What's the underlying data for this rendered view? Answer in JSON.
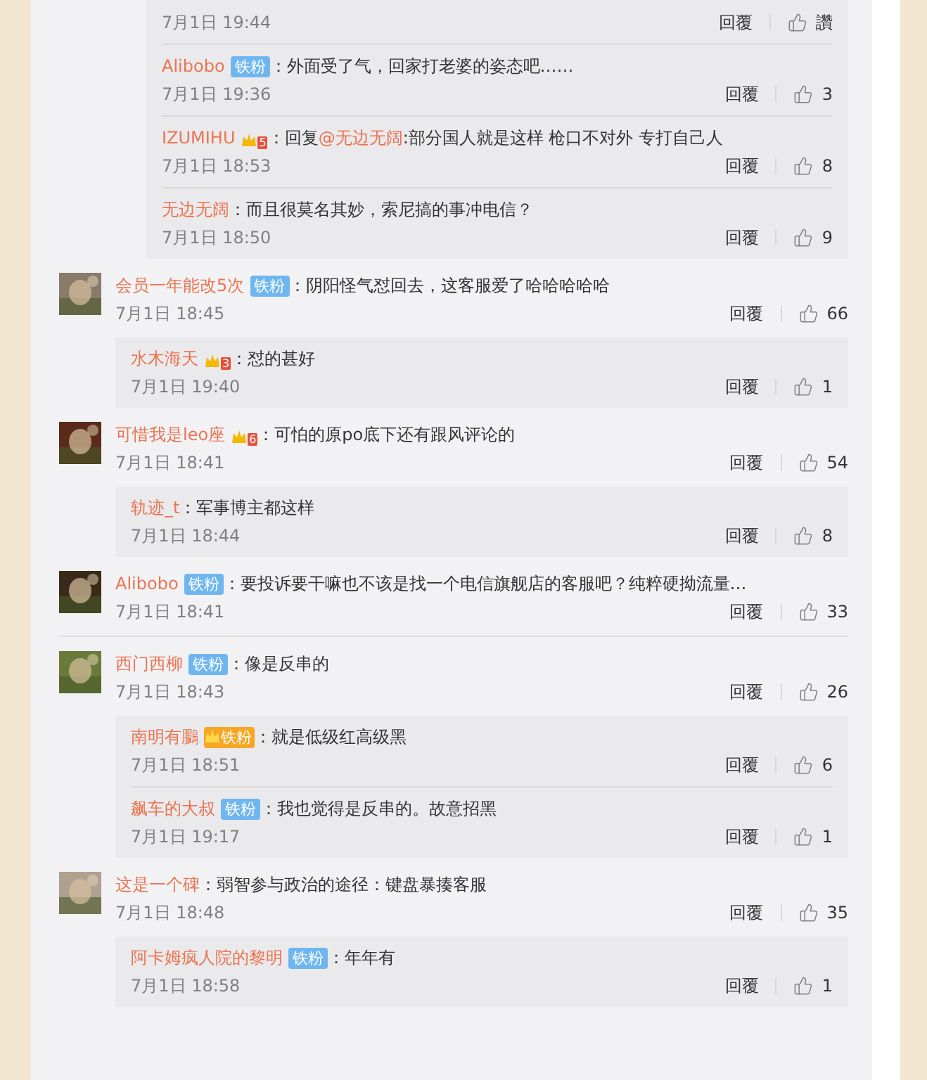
{
  "top_replies": [
    {
      "time": "7月1日 19:44",
      "reply": "回覆",
      "likes": "讚"
    },
    {
      "name": "Alibobo",
      "badge": {
        "kind": "fan",
        "text": "铁粉"
      },
      "content": [
        {
          "kind": "text",
          "text": "：外面受了气，回家打老婆的姿态吧……"
        }
      ],
      "time": "7月1日 19:36",
      "reply": "回覆",
      "likes": "3"
    },
    {
      "name": "IZUMIHU",
      "badge": {
        "kind": "vip",
        "level": "5"
      },
      "content": [
        {
          "kind": "text",
          "text": "：回复"
        },
        {
          "kind": "mention",
          "text": "@无边无阔"
        },
        {
          "kind": "text",
          "text": ":部分国人就是这样 枪口不对外 专打自己人"
        }
      ],
      "time": "7月1日 18:53",
      "reply": "回覆",
      "likes": "8"
    },
    {
      "name": "无边无阔",
      "content": [
        {
          "kind": "text",
          "text": "：而且很莫名其妙，索尼搞的事冲电信？"
        }
      ],
      "time": "7月1日 18:50",
      "reply": "回覆",
      "likes": "9"
    }
  ],
  "comments": [
    {
      "name": "会员一年能改5次",
      "badge": {
        "kind": "fan",
        "text": "铁粉"
      },
      "content": [
        {
          "kind": "text",
          "text": "：阴阳怪气怼回去，这客服爱了哈哈哈哈哈"
        }
      ],
      "time": "7月1日 18:45",
      "reply": "回覆",
      "likes": "66",
      "avatar": {
        "kind": "picture"
      },
      "replies": [
        {
          "name": "水木海天",
          "badge": {
            "kind": "vip",
            "level": "3"
          },
          "content": [
            {
              "kind": "text",
              "text": "：怼的甚好"
            }
          ],
          "time": "7月1日 19:40",
          "reply": "回覆",
          "likes": "1"
        }
      ]
    },
    {
      "name": "可惜我是leo座",
      "badge": {
        "kind": "vip",
        "level": "6"
      },
      "content": [
        {
          "kind": "text",
          "text": "：可怕的原po底下还有跟风评论的"
        }
      ],
      "time": "7月1日 18:41",
      "reply": "回覆",
      "likes": "54",
      "avatar": {
        "kind": "picture"
      },
      "replies": [
        {
          "name": "轨迹_t",
          "content": [
            {
              "kind": "text",
              "text": "：军事博主都这样"
            }
          ],
          "time": "7月1日 18:44",
          "reply": "回覆",
          "likes": "8"
        }
      ]
    },
    {
      "name": "Alibobo",
      "badge": {
        "kind": "fan",
        "text": "铁粉"
      },
      "content": [
        {
          "kind": "text",
          "text": "：要投诉要干嘛也不该是找一个电信旗舰店的客服吧？纯粹硬拗流量…"
        }
      ],
      "time": "7月1日 18:41",
      "reply": "回覆",
      "likes": "33",
      "avatar": {
        "kind": "picture"
      }
    },
    {
      "name": "西门西柳",
      "badge": {
        "kind": "fan",
        "text": "铁粉"
      },
      "content": [
        {
          "kind": "text",
          "text": "：像是反串的"
        }
      ],
      "time": "7月1日 18:43",
      "reply": "回覆",
      "likes": "26",
      "avatar": {
        "kind": "picture"
      },
      "replies": [
        {
          "name": "南明有鵩",
          "badge": {
            "kind": "vip_fan",
            "text": "铁粉"
          },
          "content": [
            {
              "kind": "text",
              "text": "：就是低级红高级黑"
            }
          ],
          "time": "7月1日 18:51",
          "reply": "回覆",
          "likes": "6"
        },
        {
          "name": "飙车的大叔",
          "badge": {
            "kind": "fan",
            "text": "铁粉"
          },
          "content": [
            {
              "kind": "text",
              "text": "：我也觉得是反串的。故意招黑"
            }
          ],
          "time": "7月1日 19:17",
          "reply": "回覆",
          "likes": "1"
        }
      ]
    },
    {
      "name": "这是一个碑",
      "content": [
        {
          "kind": "text",
          "text": "：弱智参与政治的途径：键盘暴揍客服"
        }
      ],
      "time": "7月1日 18:48",
      "reply": "回覆",
      "likes": "35",
      "avatar": {
        "kind": "picture"
      },
      "replies": [
        {
          "name": "阿卡姆疯人院的黎明",
          "badge": {
            "kind": "fan",
            "text": "铁粉"
          },
          "content": [
            {
              "kind": "text",
              "text": "：年年有"
            }
          ],
          "time": "7月1日 18:58",
          "reply": "回覆",
          "likes": "1"
        }
      ]
    }
  ]
}
